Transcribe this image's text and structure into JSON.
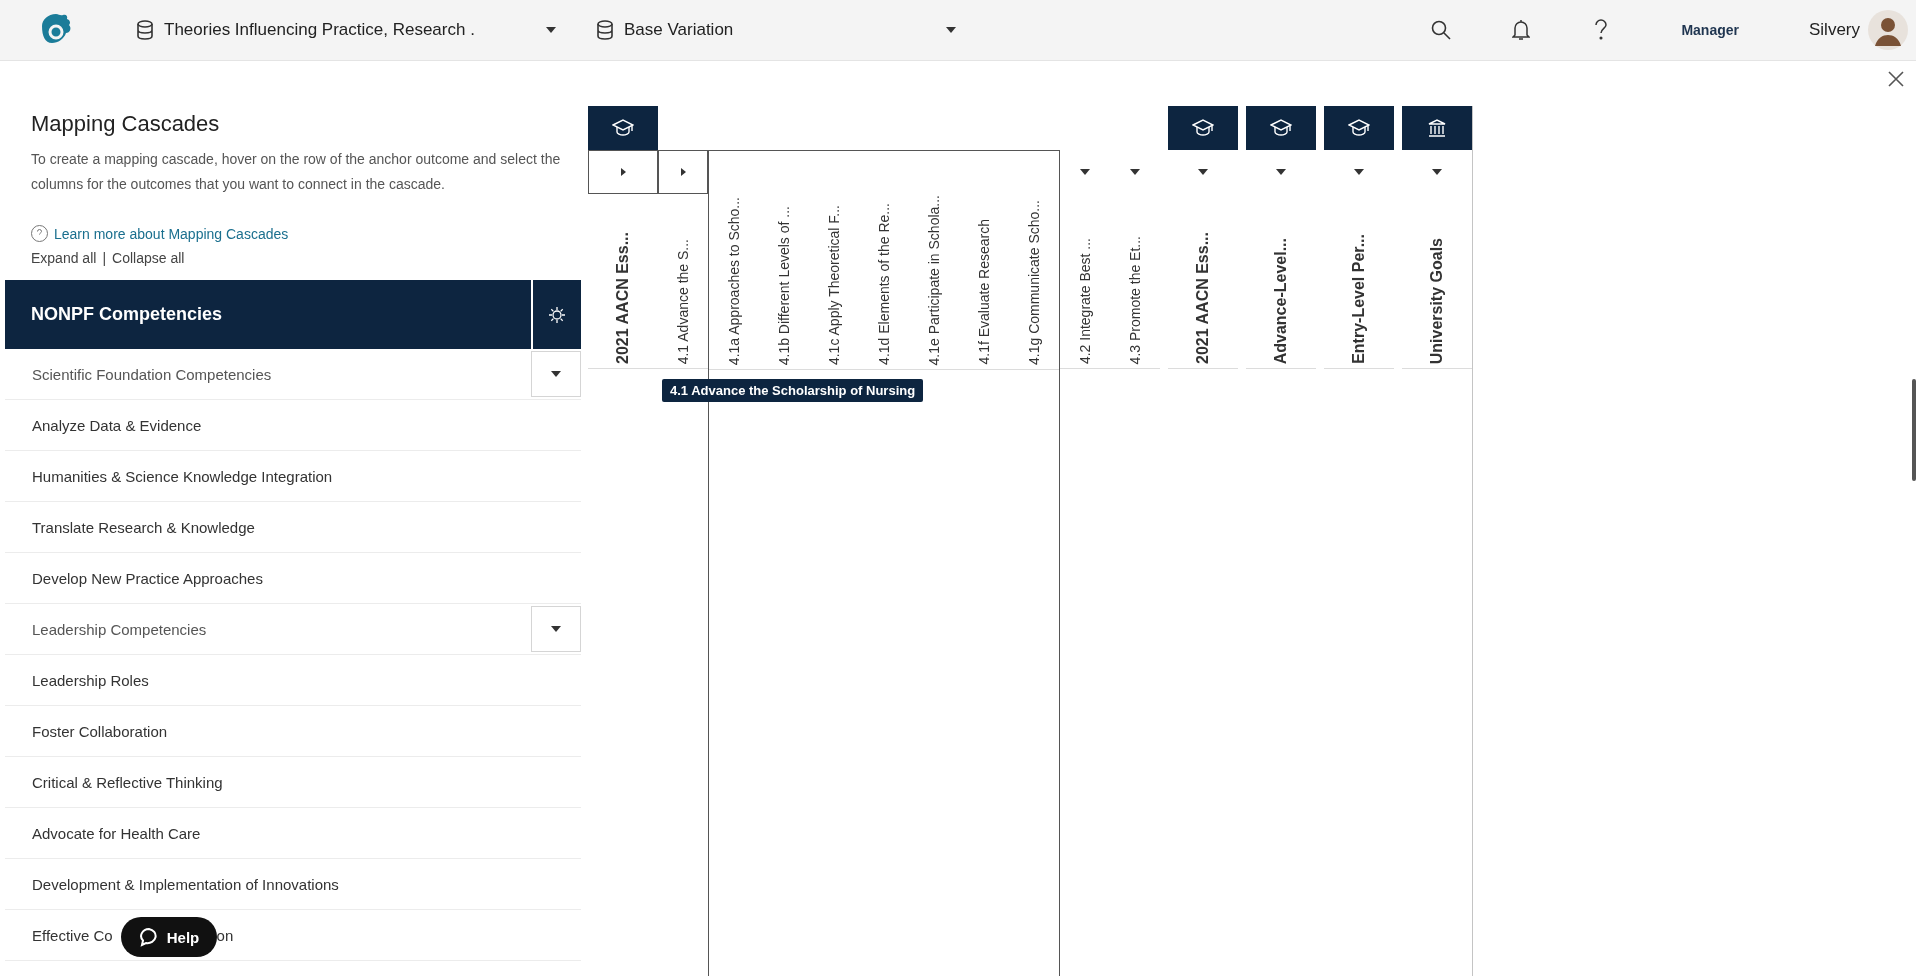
{
  "topbar": {
    "course_selector": "Theories Influencing Practice, Research .",
    "variation_selector": "Base Variation",
    "role": "Manager",
    "user": "Silvery"
  },
  "panel": {
    "title": "Mapping Cascades",
    "description": "To create a mapping cascade, hover on the row of the anchor outcome and select the columns for the outcomes that you want to connect in the cascade.",
    "learn_more": "Learn more about Mapping Cascades",
    "expand_all": "Expand all",
    "separator": "|",
    "collapse_all": "Collapse all"
  },
  "outcome_set": {
    "title": "NONPF Competencies"
  },
  "rows": [
    {
      "label": "Scientific Foundation Competencies",
      "kind": "group",
      "expanded": false
    },
    {
      "label": "Analyze Data & Evidence",
      "kind": "item"
    },
    {
      "label": "Humanities & Science Knowledge Integration",
      "kind": "item"
    },
    {
      "label": "Translate Research & Knowledge",
      "kind": "item"
    },
    {
      "label": "Develop New Practice Approaches",
      "kind": "item"
    },
    {
      "label": "Leadership Competencies",
      "kind": "group",
      "expanded": false
    },
    {
      "label": "Leadership Roles",
      "kind": "item"
    },
    {
      "label": "Foster Collaboration",
      "kind": "item"
    },
    {
      "label": "Critical & Reflective Thinking",
      "kind": "item"
    },
    {
      "label": "Advocate for Health Care",
      "kind": "item"
    },
    {
      "label": "Development & Implementation of Innovations",
      "kind": "item"
    },
    {
      "label": "Effective Co",
      "label_end": "on",
      "kind": "item"
    }
  ],
  "columns": [
    {
      "label": "2021 AACN Ess...",
      "kind": "set",
      "expanded": true
    },
    {
      "label": "4.1 Advance the S...",
      "kind": "outcome",
      "expanded": true
    },
    {
      "label": "4.1a Approaches to Scho...",
      "kind": "sub_outcome"
    },
    {
      "label": "4.1b Different Levels of ...",
      "kind": "sub_outcome"
    },
    {
      "label": "4.1c Apply Theoretical F...",
      "kind": "sub_outcome"
    },
    {
      "label": "4.1d Elements of the Re...",
      "kind": "sub_outcome"
    },
    {
      "label": "4.1e Participate in Schola...",
      "kind": "sub_outcome"
    },
    {
      "label": "4.1f Evaluate Research",
      "kind": "sub_outcome"
    },
    {
      "label": "4.1g Communicate Scho...",
      "kind": "sub_outcome"
    },
    {
      "label": "4.2 Integrate Best ...",
      "kind": "outcome",
      "expanded": false
    },
    {
      "label": "4.3 Promote the Et...",
      "kind": "outcome",
      "expanded": false
    },
    {
      "label": "2021 AACN Ess...",
      "kind": "set",
      "expanded": false
    },
    {
      "label": "Advance-Level...",
      "kind": "set",
      "expanded": false
    },
    {
      "label": "Entry-Level Per...",
      "kind": "set",
      "expanded": false
    },
    {
      "label": "University Goals",
      "kind": "institution_set",
      "expanded": false
    }
  ],
  "tooltip": "4.1 Advance the Scholarship of Nursing",
  "help_button": "Help"
}
